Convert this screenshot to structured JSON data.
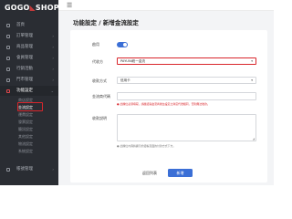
{
  "brand": {
    "logo_left": "GOGO",
    "logo_right": "SHOP"
  },
  "sidebar": {
    "items": [
      {
        "label": "首頁",
        "icon": "home-icon"
      },
      {
        "label": "訂單管理",
        "icon": "clipboard-icon"
      },
      {
        "label": "商品管理",
        "icon": "box-icon"
      },
      {
        "label": "會員管理",
        "icon": "user-icon"
      },
      {
        "label": "行銷活動",
        "icon": "tag-icon"
      },
      {
        "label": "門市管理",
        "icon": "store-icon"
      },
      {
        "label": "功能設定",
        "icon": "gear-icon"
      }
    ],
    "sub_items": [
      "商店設定",
      "金流設定",
      "運費設定",
      "發票設定",
      "簡訊設定",
      "其他設定",
      "物流設定",
      "系統設定"
    ],
    "bottom_item": {
      "label": "帳號管理",
      "icon": "account-icon"
    }
  },
  "topbar": {
    "menu_icon": "☰"
  },
  "page": {
    "title": "功能設定 / 新增金流設定"
  },
  "form": {
    "enabled_label": "啟用",
    "enabled": true,
    "provider_label": "代收方",
    "provider_value": "PAYUNi統一金流",
    "method_label": "收款方式",
    "method_value": "信用卡",
    "merchant_label": "金流商代碼",
    "merchant_value": "",
    "warning": "此欄位必須填寫，請確認與金流商後台設定之商店代號相同，否則無法收款。",
    "note_label": "收款說明",
    "note_value": "",
    "hint": "此欄位內容將顯示於結帳頁面的付款方式下方。"
  },
  "actions": {
    "back_label": "返回列表",
    "save_label": "新增"
  },
  "colors": {
    "accent": "#3b6fd6",
    "error": "#d9262c",
    "sidebar": "#2a2d33"
  }
}
